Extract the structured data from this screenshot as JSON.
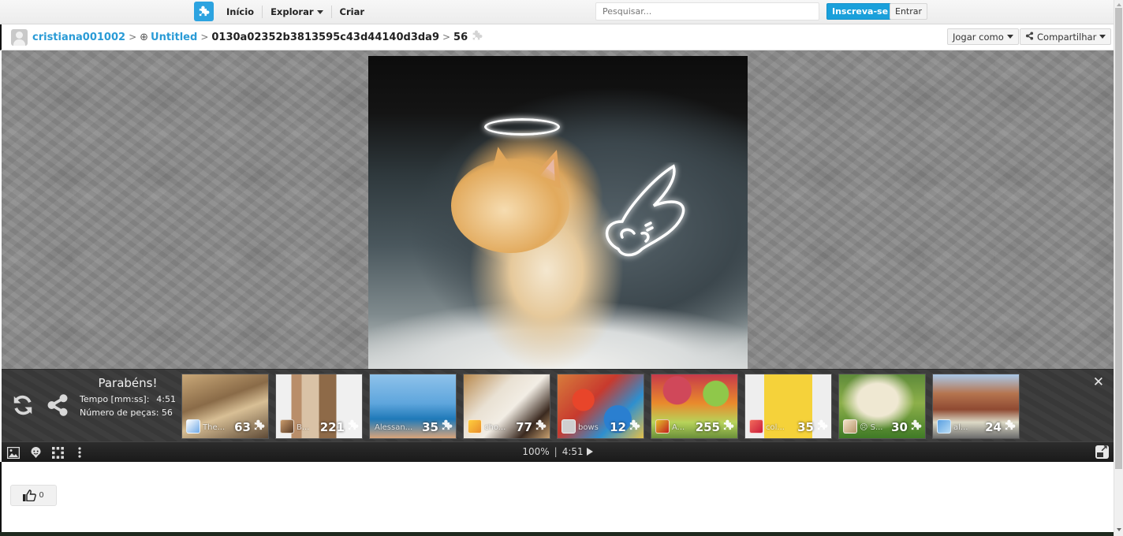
{
  "topbar": {
    "logo_icon": "puzzle-piece-icon",
    "nav": [
      {
        "label": "Início"
      },
      {
        "label": "Explorar",
        "has_dropdown": true
      },
      {
        "label": "Criar"
      }
    ],
    "search": {
      "placeholder": "Pesquisar...",
      "value": ""
    },
    "signup_label": "Inscreva-se",
    "login_label": "Entrar"
  },
  "breadcrumb": {
    "user": "cristiana001002",
    "album": "Untitled",
    "puzzle_id": "0130a02352b3813595c43d44140d3da9",
    "pieces": "56",
    "separator": ">",
    "globe_glyph": "⊕"
  },
  "actions": {
    "play_as_label": "Jogar como",
    "share_label": "Compartilhar"
  },
  "puzzle": {
    "subject": "angel kitten with halo and wings"
  },
  "completion": {
    "title": "Parabéns!",
    "time_label": "Tempo [mm:ss]:",
    "time_value": "4:51",
    "pieces_label": "Número de peças:",
    "pieces_value": "56",
    "close_glyph": "✕"
  },
  "suggestions": [
    {
      "author": "The...",
      "pieces": "63",
      "bg": "linear-gradient(160deg,#c9a878 0%,#8a6b48 40%,#d8bf95 60%,#5e4a36 100%)",
      "avatar_bg": "linear-gradient(135deg,#ffffff,#6fa9e6)"
    },
    {
      "author": "B...",
      "pieces": "221",
      "bg": "linear-gradient(90deg,#f0f0f0 0 18%,#b98e6a 18% 30%,#d9c2a6 30% 50%,#8e6a48 50% 70%,#f0f0f0 70%)",
      "avatar_bg": "linear-gradient(135deg,#c99a6b,#5a3d28)"
    },
    {
      "author": "Alessan...",
      "pieces": "35",
      "bg": "linear-gradient(180deg,#8ec2ea 0%,#5fa6dd 45%,#1f79b8 70%,#d9a47a 100%)",
      "avatar_bg": ""
    },
    {
      "author": "cho...",
      "pieces": "77",
      "bg": "linear-gradient(135deg,#b8894e 0%,#e9e1d3 35%,#f2ede4 55%,#3b2a20 80%,#c8a070 100%)",
      "avatar_bg": "linear-gradient(135deg,#ffcf3e,#e88c2c)"
    },
    {
      "author": "bows",
      "pieces": "12",
      "bg": "radial-gradient(circle at 30% 40%,#e8452a 0 15%,transparent 16%),radial-gradient(circle at 70% 70%,#2a7fd0 0 18%,transparent 19%),linear-gradient(135deg,#d77c3c,#c83a2e 40%,#2e8fcf 70%,#e3c04a)",
      "avatar_bg": "#cfcfcf"
    },
    {
      "author": "A...",
      "pieces": "255",
      "bg": "radial-gradient(circle at 30% 25%,#d0485a 0 18%,transparent 19%),radial-gradient(circle at 75% 30%,#8fc84a 0 16%,transparent 17%),linear-gradient(180deg,#c73a4a 0%,#e98a2c 45%,#b7d35a 75%,#6a8f3a 100%)",
      "avatar_bg": "linear-gradient(135deg,#e3c12a,#c21e1e)"
    },
    {
      "author": "col...",
      "pieces": "35",
      "bg": "linear-gradient(90deg,#eeeeee 0 22%,#f5d23a 22% 78%,#eeeeee 78%)",
      "avatar_bg": "linear-gradient(135deg,#f26a5a,#c91e3c)"
    },
    {
      "author": "☹ S...",
      "pieces": "30",
      "bg": "radial-gradient(ellipse at 45% 40%,#efe8d2 0 30%,transparent 55%),linear-gradient(180deg,#5e8a3a 0%,#8db04a 45%,#3f7a26 100%)",
      "avatar_bg": "linear-gradient(135deg,#f3e3c8,#b6946a)"
    },
    {
      "author": "al...",
      "pieces": "24",
      "bg": "linear-gradient(180deg,#a9c8e8 0%,#b5744f 30%,#8f4a32 55%,#dcd9c6 75%,#6c6c6c 100%)",
      "avatar_bg": "linear-gradient(135deg,#5aa0e0,#b8dcf5)"
    }
  ],
  "controls": {
    "zoom": "100%",
    "timer": "4:51",
    "separator": "|",
    "icons": [
      "image-preview-icon",
      "ghost-icon",
      "grid-icon",
      "more-vertical-icon"
    ]
  },
  "footer": {
    "likes": "0"
  }
}
